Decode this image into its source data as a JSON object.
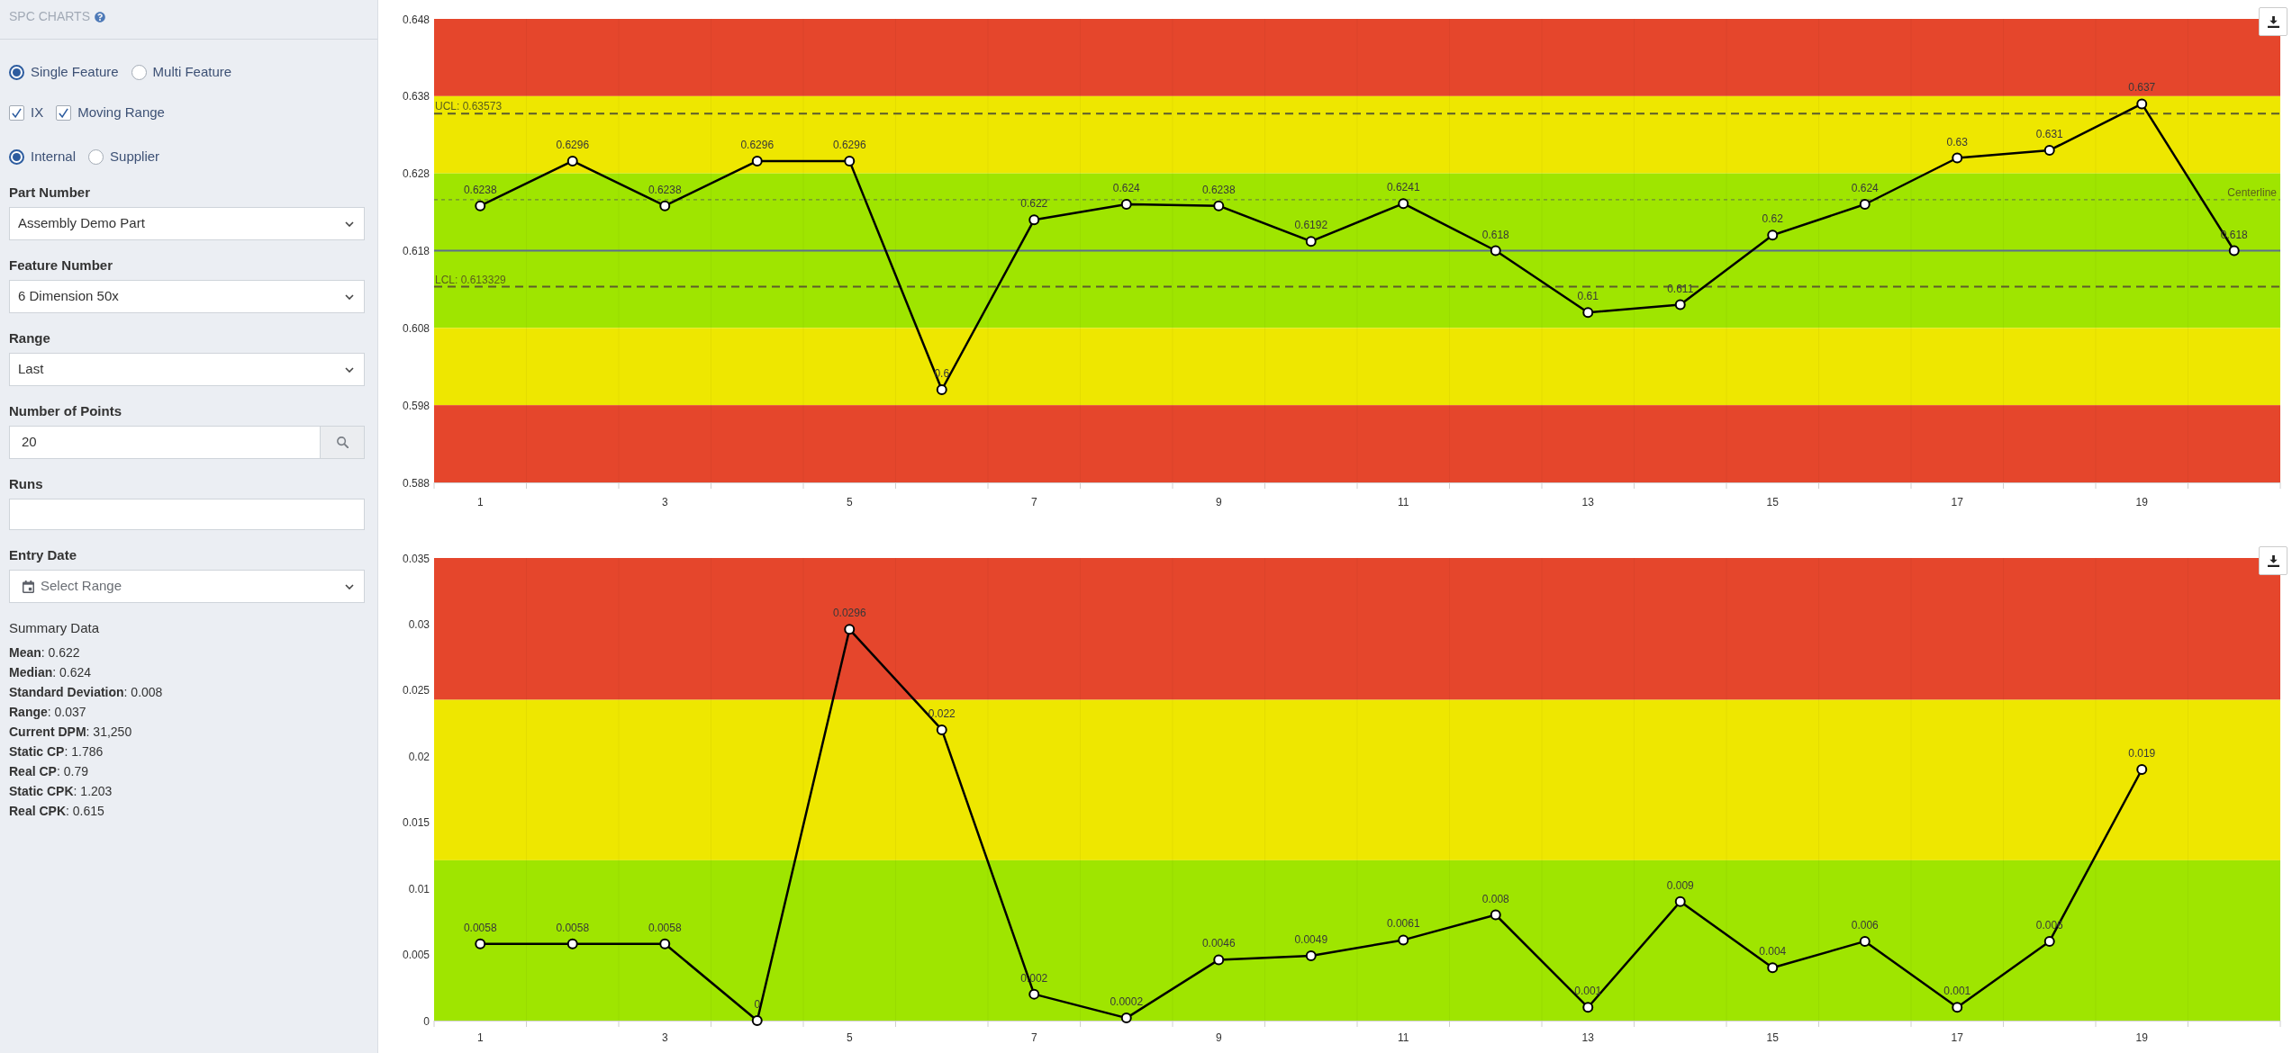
{
  "sidebar": {
    "title": "SPC CHARTS",
    "feature_mode": [
      {
        "label": "Single Feature",
        "selected": true
      },
      {
        "label": "Multi Feature",
        "selected": false
      }
    ],
    "chart_options": [
      {
        "label": "IX",
        "checked": true
      },
      {
        "label": "Moving Range",
        "checked": true
      }
    ],
    "source": [
      {
        "label": "Internal",
        "selected": true
      },
      {
        "label": "Supplier",
        "selected": false
      }
    ],
    "fields": [
      {
        "kind": "select",
        "label": "Part Number",
        "value": "Assembly Demo Part"
      },
      {
        "kind": "select",
        "label": "Feature Number",
        "value": "6 Dimension 50x"
      },
      {
        "kind": "select",
        "label": "Range",
        "value": "Last"
      },
      {
        "kind": "search",
        "label": "Number of Points",
        "value": "20"
      },
      {
        "kind": "text",
        "label": "Runs"
      },
      {
        "kind": "date",
        "label": "Entry Date",
        "placeholder": "Select Range"
      }
    ],
    "summary": {
      "title": "Summary Data",
      "lines": [
        "**Mean**: 0.622",
        "**Median**: 0.624",
        "**Standard Deviation**: 0.008",
        "**Range**: 0.037",
        "**Current DPM**: 31,250",
        "**Static CP**: 1.786",
        "**Real CP**: 0.79",
        "**Static CPK**: 1.203",
        "**Real CPK**: 0.615"
      ]
    }
  },
  "charts": [
    {
      "chart_data": {
        "type": "line",
        "x": [
          1,
          2,
          3,
          4,
          5,
          6,
          7,
          8,
          9,
          10,
          11,
          12,
          13,
          14,
          15,
          16,
          17,
          18,
          19,
          20
        ],
        "values": [
          0.6238,
          0.6296,
          0.6238,
          0.6296,
          0.6296,
          0.6,
          0.622,
          0.624,
          0.6238,
          0.6192,
          0.6241,
          0.618,
          0.61,
          0.611,
          0.62,
          0.624,
          0.63,
          0.631,
          0.637,
          0.618
        ],
        "marker": "circle",
        "xlim": [
          0.5,
          20.5
        ],
        "ylim": [
          0.588,
          0.648
        ],
        "yticks": [
          0.588,
          0.598,
          0.608,
          0.618,
          0.628,
          0.638,
          0.648
        ],
        "xticks": [
          1,
          3,
          5,
          7,
          9,
          11,
          13,
          15,
          17,
          19
        ],
        "data_labels": true,
        "bands": [
          {
            "axis": "y",
            "from": 0.638,
            "to": 0.648,
            "color": "#e5462c"
          },
          {
            "axis": "y",
            "from": 0.628,
            "to": 0.638,
            "color": "#eee700"
          },
          {
            "axis": "y",
            "from": 0.608,
            "to": 0.628,
            "color": "#9fe500"
          },
          {
            "axis": "y",
            "from": 0.598,
            "to": 0.608,
            "color": "#eee700"
          },
          {
            "axis": "y",
            "from": 0.588,
            "to": 0.598,
            "color": "#e5462c"
          }
        ],
        "ref_lines": [
          {
            "axis": "y",
            "value": 0.63573,
            "label": "UCL: 0.63573"
          },
          {
            "axis": "y",
            "value": 0.6246,
            "label": "Centerline"
          },
          {
            "axis": "y",
            "value": 0.618
          },
          {
            "axis": "y",
            "value": 0.613329,
            "label": "LCL: 0.613329"
          }
        ]
      }
    },
    {
      "chart_data": {
        "type": "line",
        "x": [
          1,
          2,
          3,
          4,
          5,
          6,
          7,
          8,
          9,
          10,
          11,
          12,
          13,
          14,
          15,
          16,
          17,
          18,
          19
        ],
        "values": [
          0.0058,
          0.0058,
          0.0058,
          0,
          0.0296,
          0.022,
          0.002,
          0.0002,
          0.0046,
          0.0049,
          0.0061,
          0.008,
          0.001,
          0.009,
          0.004,
          0.006,
          0.001,
          0.006,
          0.019
        ],
        "marker": "circle",
        "xlim": [
          0.5,
          20.5
        ],
        "ylim": [
          0,
          0.035
        ],
        "yticks": [
          0,
          0.005,
          0.01,
          0.015,
          0.02,
          0.025,
          0.03,
          0.035
        ],
        "xticks": [
          1,
          3,
          5,
          7,
          9,
          11,
          13,
          15,
          17,
          19
        ],
        "data_labels": true,
        "bands": [
          {
            "axis": "y",
            "from": 0.02427,
            "to": 0.035,
            "color": "#e5462c"
          },
          {
            "axis": "y",
            "from": 0.01213,
            "to": 0.02427,
            "color": "#eee700"
          },
          {
            "axis": "y",
            "from": 0,
            "to": 0.01213,
            "color": "#9fe500"
          }
        ]
      }
    }
  ]
}
